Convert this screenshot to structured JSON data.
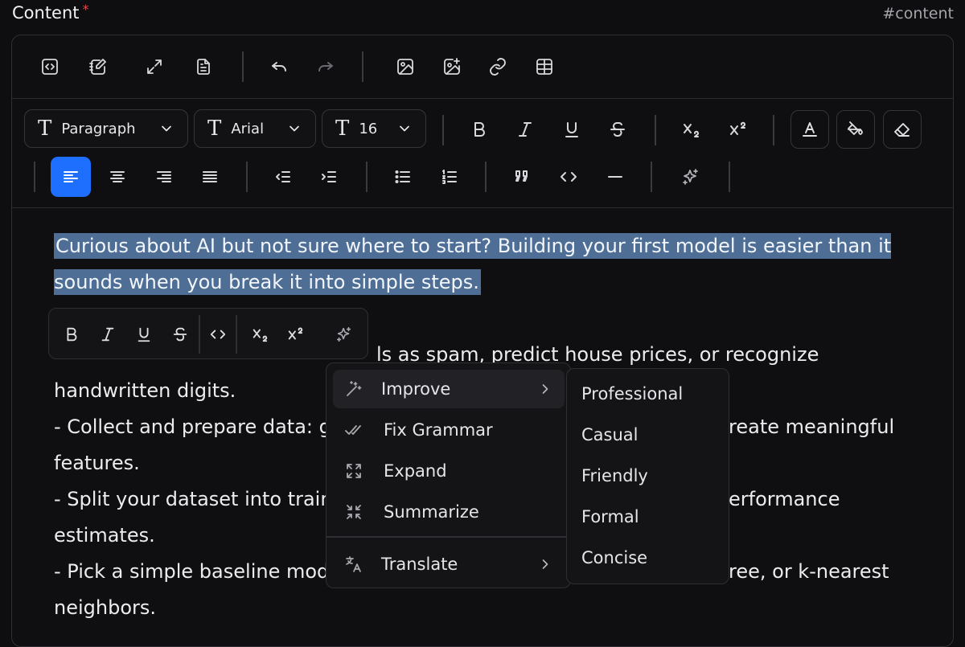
{
  "field": {
    "label": "Content",
    "required_mark": "*",
    "tag": "#content"
  },
  "toolbar": {
    "row1_icons": [
      "code-view-icon",
      "edit-note-icon",
      "fullscreen-icon",
      "document-icon",
      "undo-icon",
      "redo-icon",
      "image-icon",
      "add-image-icon",
      "link-icon",
      "table-icon"
    ],
    "block_type": "Paragraph",
    "font_family": "Arial",
    "font_size": "16",
    "align_active": "left",
    "accent_color": "#1f6fff"
  },
  "content": {
    "selected_text": "Curious about AI but not sure where to start? Building your first model is easier than it sounds when you break it into simple steps.",
    "line2_visible": "ls as spam, predict house prices, or recognize",
    "line3": "handwritten digits.",
    "line4_left": "- Collect and prepare data: ga",
    "line4_right": "reate meaningful",
    "line5": "features.",
    "line6_left": "- Split your dataset into traini",
    "line6_right": "erformance",
    "line7": "estimates.",
    "line8_left": "- Pick a simple baseline mode",
    "line8_right": "ree, or k-nearest",
    "line9": "neighbors.",
    "selection_color": "#4e6e95"
  },
  "bubble_menu": {
    "icons": [
      "bold-icon",
      "italic-icon",
      "underline-icon",
      "strikethrough-icon",
      "code-icon",
      "subscript-icon",
      "superscript-icon",
      "ai-sparkle-icon"
    ]
  },
  "ai_menu": {
    "items": [
      {
        "label": "Improve",
        "icon": "magic-wand-icon",
        "has_submenu": true,
        "active": true
      },
      {
        "label": "Fix Grammar",
        "icon": "double-check-icon"
      },
      {
        "label": "Expand",
        "icon": "expand-icon"
      },
      {
        "label": "Summarize",
        "icon": "collapse-icon"
      },
      {
        "label": "Translate",
        "icon": "translate-icon",
        "has_submenu": true
      }
    ],
    "submenu": [
      "Professional",
      "Casual",
      "Friendly",
      "Formal",
      "Concise"
    ]
  }
}
